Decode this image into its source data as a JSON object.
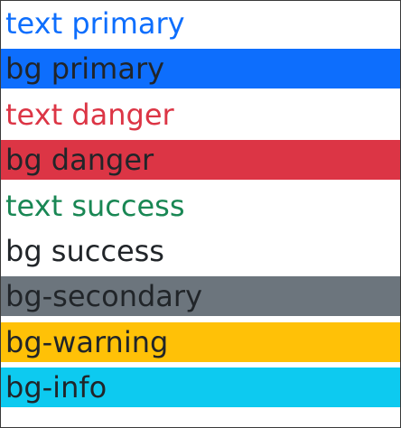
{
  "lines": [
    {
      "label": "text primary",
      "text_color": "#0d6efd",
      "bg": ""
    },
    {
      "label": "bg primary",
      "text_color": "#212529",
      "bg": "#0d6efd"
    },
    {
      "label": "text danger",
      "text_color": "#dc3545",
      "bg": ""
    },
    {
      "label": "bg danger",
      "text_color": "#212529",
      "bg": "#dc3545"
    },
    {
      "label": "text success",
      "text_color": "#198754",
      "bg": ""
    },
    {
      "label": "bg success",
      "text_color": "#212529",
      "bg": ""
    },
    {
      "label": "bg-secondary",
      "text_color": "#212529",
      "bg": "#6c757d"
    },
    {
      "label": "bg-warning",
      "text_color": "#212529",
      "bg": "#ffc107"
    },
    {
      "label": "bg-info",
      "text_color": "#212529",
      "bg": "#0dcaf0"
    }
  ]
}
